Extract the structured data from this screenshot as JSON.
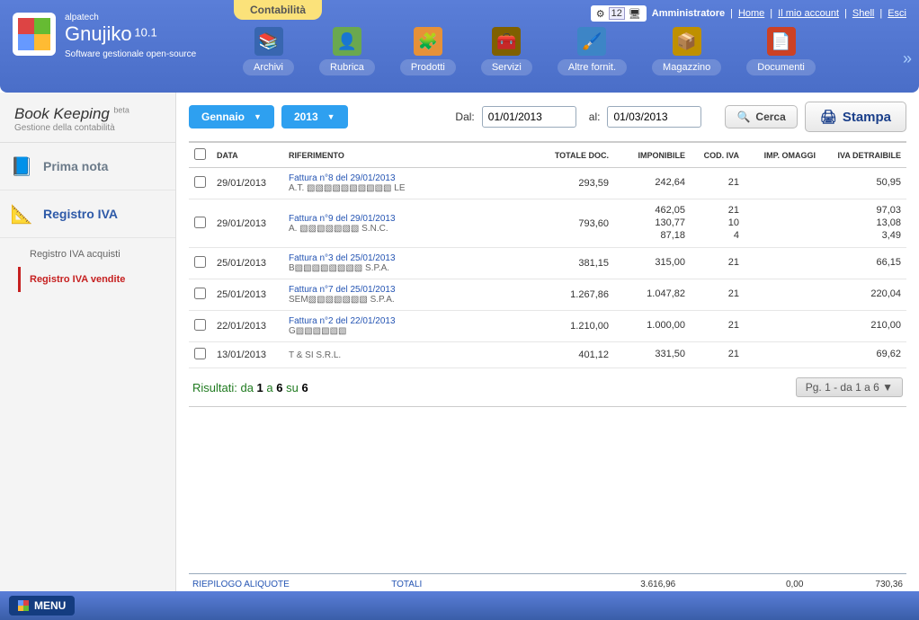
{
  "brand": {
    "company": "alpatech",
    "name": "Gnujiko",
    "version": "10.1",
    "tagline": "Software gestionale open-source"
  },
  "context_tab": "Contabilità",
  "top_right": {
    "role": "Amministratore",
    "links": [
      "Home",
      "Il mio account",
      "Shell",
      "Esci"
    ],
    "cal_day": "12"
  },
  "nav": [
    {
      "label": "Archivi",
      "color": "#3866b0",
      "glyph": "📚"
    },
    {
      "label": "Rubrica",
      "color": "#6aa84f",
      "glyph": "👤"
    },
    {
      "label": "Prodotti",
      "color": "#e69138",
      "glyph": "🧩"
    },
    {
      "label": "Servizi",
      "color": "#7f6000",
      "glyph": "🧰"
    },
    {
      "label": "Altre fornit.",
      "color": "#3d85c6",
      "glyph": "🖌️"
    },
    {
      "label": "Magazzino",
      "color": "#bf9000",
      "glyph": "📦"
    },
    {
      "label": "Documenti",
      "color": "#cc4125",
      "glyph": "📄"
    }
  ],
  "module": {
    "title": "Book Keeping",
    "badge": "beta",
    "subtitle": "Gestione della contabilità"
  },
  "side": {
    "prima": "Prima nota",
    "registro": "Registro IVA",
    "sub1": "Registro IVA acquisti",
    "sub2": "Registro IVA vendite"
  },
  "toolbar": {
    "month": "Gennaio",
    "year": "2013",
    "dal_label": "Dal:",
    "al_label": "al:",
    "dal": "01/01/2013",
    "al": "01/03/2013",
    "search": "Cerca",
    "print": "Stampa"
  },
  "columns": {
    "c0": "",
    "c1": "DATA",
    "c2": "RIFERIMENTO",
    "c3": "TOTALE DOC.",
    "c4": "IMPONIBILE",
    "c5": "COD. IVA",
    "c6": "IMP. OMAGGI",
    "c7": "IVA DETRAIBILE"
  },
  "rows": [
    {
      "date": "29/01/2013",
      "ref": "Fattura n°8 del 29/01/2013",
      "sub": "A.T. ▧▧▧▧▧▧▧▧▧▧ LE",
      "tot": "293,59",
      "imp": "242,64",
      "cod": "21",
      "om": "",
      "iva": "50,95"
    },
    {
      "date": "29/01/2013",
      "ref": "Fattura n°9 del 29/01/2013",
      "sub": "A. ▧▧▧▧▧▧▧ S.N.C.",
      "tot": "793,60",
      "imp": "462,05\n130,77\n87,18",
      "cod": "21\n10\n4",
      "om": "",
      "iva": "97,03\n13,08\n3,49"
    },
    {
      "date": "25/01/2013",
      "ref": "Fattura n°3 del 25/01/2013",
      "sub": "B▧▧▧▧▧▧▧▧ S.P.A.",
      "tot": "381,15",
      "imp": "315,00",
      "cod": "21",
      "om": "",
      "iva": "66,15"
    },
    {
      "date": "25/01/2013",
      "ref": "Fattura n°7 del 25/01/2013",
      "sub": "SEM▧▧▧▧▧▧▧ S.P.A.",
      "tot": "1.267,86",
      "imp": "1.047,82",
      "cod": "21",
      "om": "",
      "iva": "220,04"
    },
    {
      "date": "22/01/2013",
      "ref": "Fattura n°2 del 22/01/2013",
      "sub": "G▧▧▧▧▧▧",
      "tot": "1.210,00",
      "imp": "1.000,00",
      "cod": "21",
      "om": "",
      "iva": "210,00"
    },
    {
      "date": "13/01/2013",
      "ref": "",
      "sub": "T & SI S.R.L.",
      "tot": "401,12",
      "imp": "331,50",
      "cod": "21",
      "om": "",
      "iva": "69,62"
    }
  ],
  "results": {
    "prefix": "Risultati: da",
    "a": "1",
    "mid": "a",
    "b": "6",
    "su": "su",
    "tot": "6",
    "pager": "Pg. 1 - da 1 a 6  ▼"
  },
  "summary": {
    "label": "RIEPILOGO ALIQUOTE",
    "totali": "TOTALI",
    "imp": "3.616,96",
    "om": "0,00",
    "iva": "730,36"
  },
  "footer": {
    "menu": "MENU"
  }
}
